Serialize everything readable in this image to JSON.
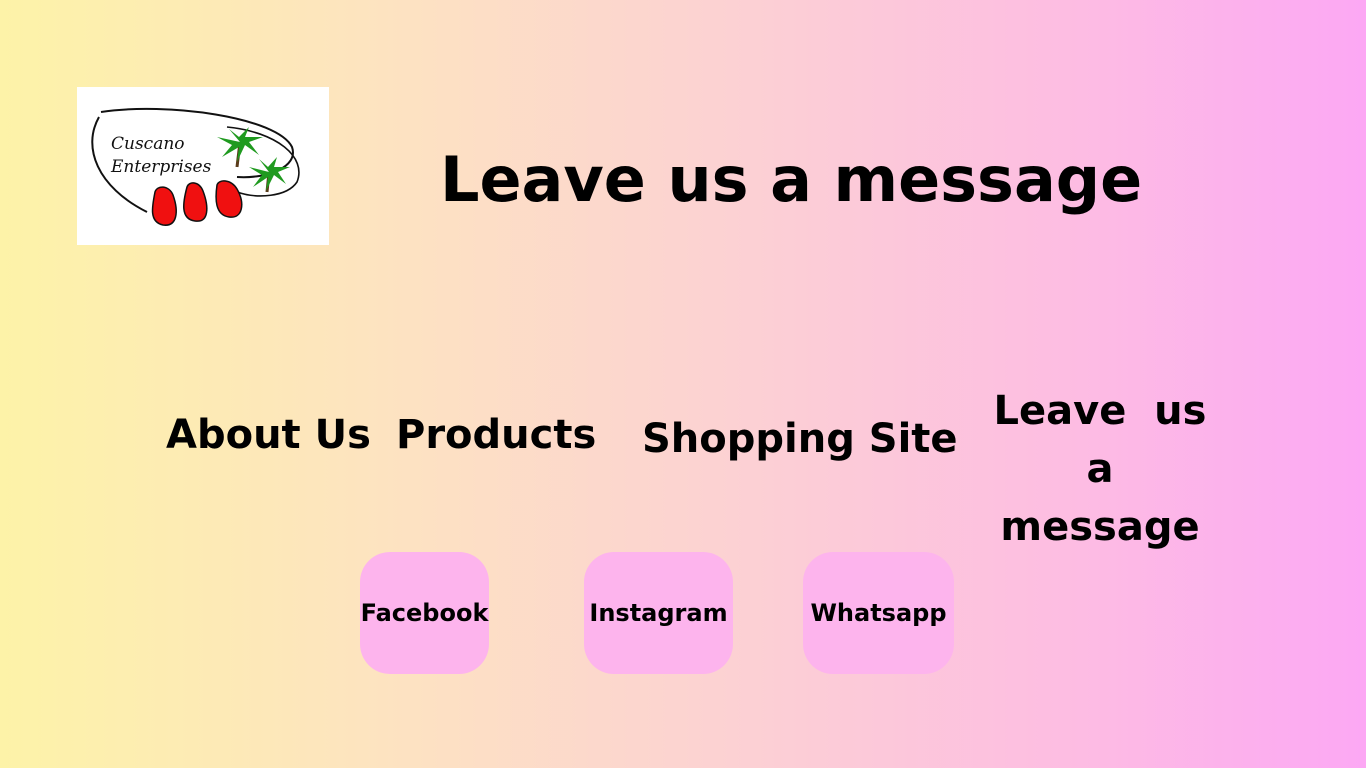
{
  "logo": {
    "line1": "Cuscano",
    "line2": "Enterprises"
  },
  "page": {
    "title": "Leave us a message"
  },
  "nav": {
    "about": "About Us",
    "products": "Products",
    "shopping": "Shopping Site",
    "leave_line1": "Leave  us",
    "leave_line2": "a message"
  },
  "social": {
    "facebook": "Facebook",
    "instagram": "Instagram",
    "whatsapp": "Whatsapp"
  },
  "colors": {
    "gradient_start": "#fdf3a8",
    "gradient_end": "#fca8f4",
    "button_bg": "#fdb4ed"
  }
}
